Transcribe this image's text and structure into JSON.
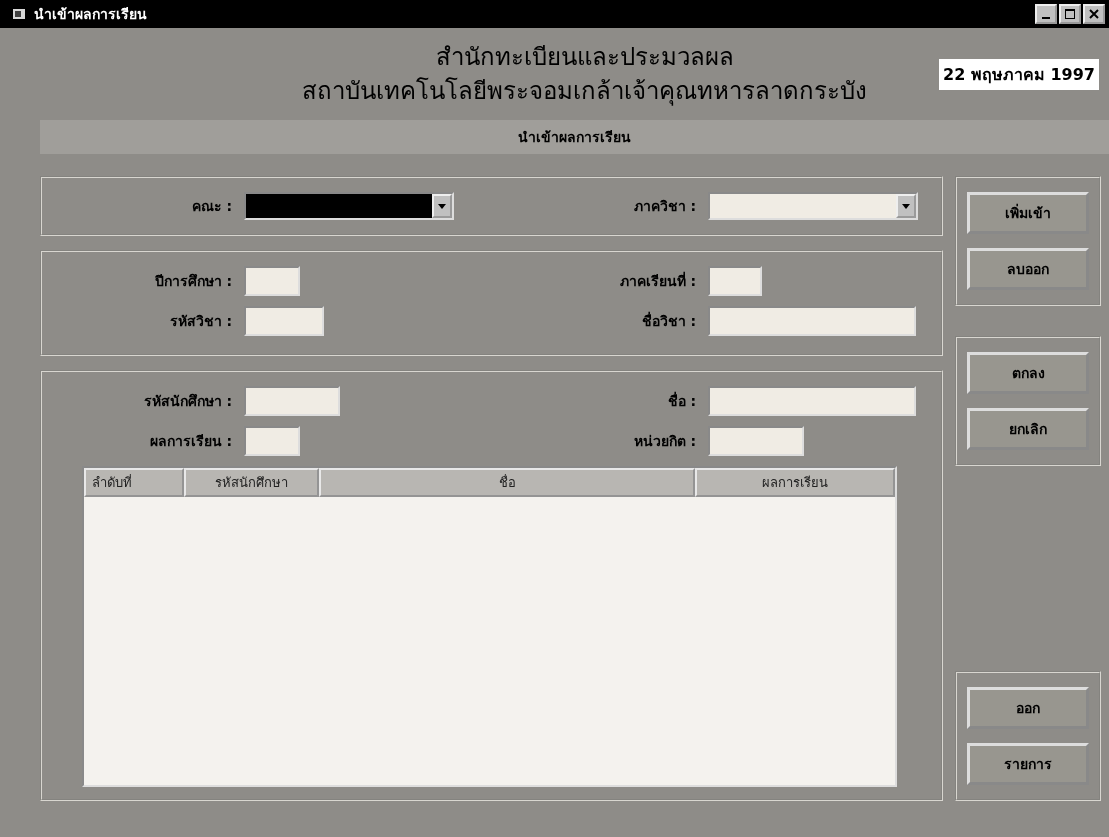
{
  "window": {
    "title": "นำเข้าผลการเรียน"
  },
  "header": {
    "lines": [
      "สำนักทะเบียนและประมวลผล",
      "สถาบันเทคโนโลยีพระจอมเกล้าเจ้าคุณทหารลาดกระบัง"
    ],
    "date": "22 พฤษภาคม 1997",
    "subtitle": "นำเข้าผลการเรียน"
  },
  "department_group": {
    "fields": [
      {
        "label": "คณะ :",
        "focused": true
      },
      {
        "label": "ภาควิชา :",
        "focused": false
      }
    ]
  },
  "course_group": {
    "fields": [
      {
        "label": "ปีการศึกษา :"
      },
      {
        "label": "ภาคเรียนที่ :"
      },
      {
        "label": "รหัสวิชา :"
      },
      {
        "label": "ชื่อวิชา :"
      }
    ]
  },
  "student_group": {
    "fields": [
      {
        "label": "รหัสนักศึกษา :"
      },
      {
        "label": "ชื่อ :"
      },
      {
        "label": "ผลการเรียน :"
      },
      {
        "label": "หน่วยกิต :"
      }
    ],
    "table": {
      "columns": [
        "ลำดับที่",
        "รหัสนักศึกษา",
        "ชื่อ",
        "ผลการเรียน"
      ]
    }
  },
  "button_groups": [
    [
      "เพิ่มเข้า",
      "ลบออก"
    ],
    [
      "ตกลง",
      "ยกเลิก"
    ],
    [
      "ออก",
      "รายการ"
    ]
  ]
}
